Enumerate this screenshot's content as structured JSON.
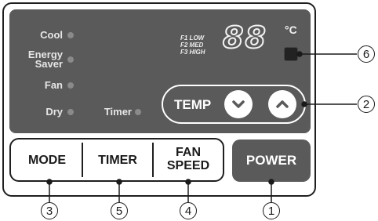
{
  "indicators": {
    "cool": "Cool",
    "energy_saver_line1": "Energy",
    "energy_saver_line2": "Saver",
    "fan": "Fan",
    "dry": "Dry",
    "timer": "Timer"
  },
  "fan_legend": [
    "F1 LOW",
    "F2 MED",
    "F3 HIGH"
  ],
  "display_digits": "88",
  "temperature_unit": "°C",
  "temp_control": {
    "label": "TEMP",
    "down_icon": "chevron-down-icon",
    "up_icon": "chevron-up-icon"
  },
  "buttons": {
    "mode": "MODE",
    "timer": "TIMER",
    "fan_speed_line1": "FAN",
    "fan_speed_line2": "SPEED",
    "power": "POWER"
  },
  "callouts": {
    "mode": "3",
    "timer": "5",
    "fan_speed": "4",
    "power": "1",
    "temp": "2",
    "sensor": "6"
  },
  "colors": {
    "display_bg": "#5a5a5a",
    "led": "#8a8a8a",
    "button_bg": "#5a5a5a",
    "outline": "#1f1f1f"
  }
}
